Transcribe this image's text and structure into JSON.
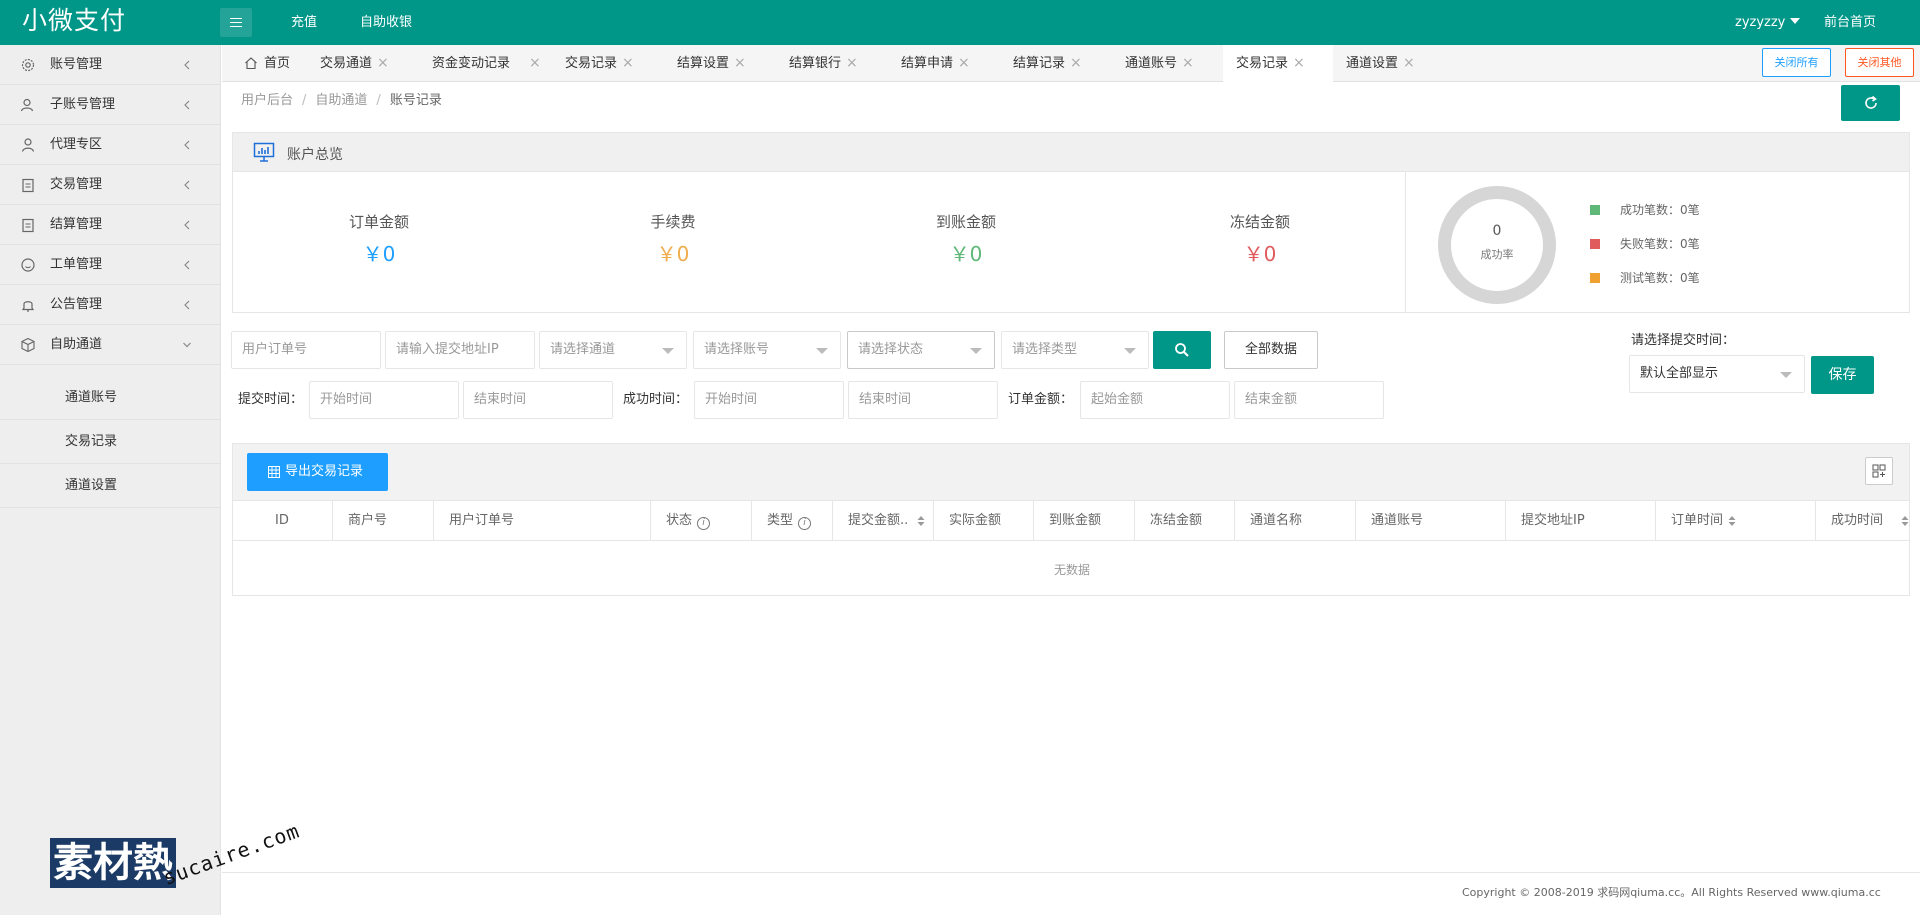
{
  "header": {
    "logo": "小微支付",
    "nav": [
      "充值",
      "自助收银"
    ],
    "user": "zyzyzzy",
    "home": "前台首页"
  },
  "sidebar": {
    "items": [
      {
        "label": "账号管理",
        "icon": "gear-icon"
      },
      {
        "label": "子账号管理",
        "icon": "users-icon"
      },
      {
        "label": "代理专区",
        "icon": "user-icon"
      },
      {
        "label": "交易管理",
        "icon": "clipboard-icon"
      },
      {
        "label": "结算管理",
        "icon": "clipboard-icon"
      },
      {
        "label": "工单管理",
        "icon": "smile-icon"
      },
      {
        "label": "公告管理",
        "icon": "bell-icon"
      },
      {
        "label": "自助通道",
        "icon": "cube-icon"
      }
    ],
    "subitems": [
      "通道账号",
      "交易记录",
      "通道设置"
    ]
  },
  "tabs": {
    "items": [
      "首页",
      "交易通道",
      "资金变动记录",
      "交易记录",
      "结算设置",
      "结算银行",
      "结算申请",
      "结算记录",
      "通道账号",
      "交易记录",
      "通道设置"
    ],
    "close_all": "关闭所有",
    "close_other": "关闭其他"
  },
  "breadcrumb": [
    "用户后台",
    "自助通道",
    "账号记录"
  ],
  "overview": {
    "title": "账户总览",
    "stats": [
      {
        "label": "订单金额",
        "value": "￥0",
        "color": "#1e9fff"
      },
      {
        "label": "手续费",
        "value": "￥0",
        "color": "#f0ad4e"
      },
      {
        "label": "到账金额",
        "value": "￥0",
        "color": "#5fb878"
      },
      {
        "label": "冻结金额",
        "value": "￥0",
        "color": "#e05c5c"
      }
    ],
    "rate_value": "0",
    "rate_label": "成功率",
    "legend": [
      {
        "label": "成功笔数：0笔",
        "color": "#5fb878"
      },
      {
        "label": "失败笔数：0笔",
        "color": "#e05c5c"
      },
      {
        "label": "测试笔数：0笔",
        "color": "#f0a030"
      }
    ]
  },
  "filters": {
    "order_no": "用户订单号",
    "submit_ip": "请输入提交地址IP",
    "channel": "请选择通道",
    "account": "请选择账号",
    "status": "请选择状态",
    "type": "请选择类型",
    "all_data": "全部数据",
    "submit_time_label": "提交时间：",
    "success_time_label": "成功时间：",
    "amount_label": "订单金额：",
    "start_time": "开始时间",
    "end_time": "结束时间",
    "start_amount": "起始金额",
    "end_amount": "结束金额",
    "time_select_label": "请选择提交时间：",
    "time_select_value": "默认全部显示",
    "save": "保存"
  },
  "table": {
    "export": "导出交易记录",
    "columns": [
      "ID",
      "商户号",
      "用户订单号",
      "状态",
      "类型",
      "提交金额..",
      "实际金额",
      "到账金额",
      "冻结金额",
      "通道名称",
      "通道账号",
      "提交地址IP",
      "订单时间",
      "成功时间"
    ],
    "empty": "无数据"
  },
  "footer": {
    "copyright": "Copyright © 2008-2019 求码网qiuma.cc。All Rights Reserved www.qiuma.cc"
  },
  "watermark": {
    "text": "素材熱",
    "url": "sucaire.com"
  },
  "colors": {
    "primary": "#009688",
    "blue": "#1e9fff",
    "danger": "#ff5722"
  }
}
